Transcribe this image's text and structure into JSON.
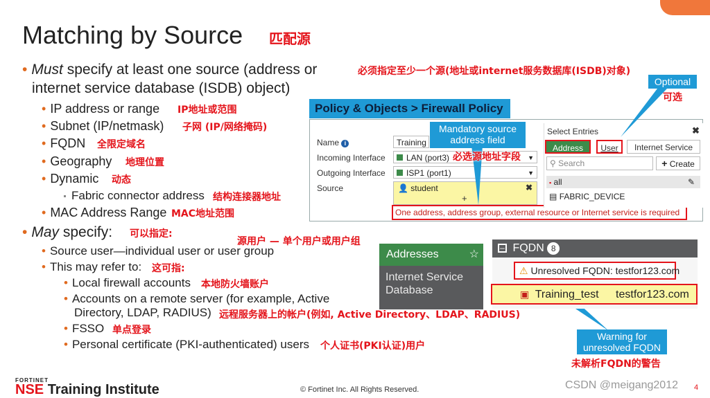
{
  "title": "Matching by Source",
  "title_cn": "匹配源",
  "must": {
    "em": "Must",
    "line1": " specify at least one source (address or",
    "line2": "internet service database (ISDB) object)",
    "cn": "必须指定至少一个源(地址或internet服务数据库(ISDB)对象)",
    "items": [
      {
        "text": "IP address or range",
        "cn": "IP地址或范围"
      },
      {
        "text": "Subnet (IP/netmask)",
        "cn": "子网 (IP/网络掩码)"
      },
      {
        "text": "FQDN",
        "cn": "全限定域名"
      },
      {
        "text": "Geography",
        "cn": "地理位置"
      },
      {
        "text": "Dynamic",
        "cn": "动态"
      },
      {
        "text": "Fabric connector address",
        "cn": "结构连接器地址"
      },
      {
        "text": "MAC Address Range",
        "cn": "MAC地址范围"
      }
    ]
  },
  "may": {
    "em": "May",
    "rest": " specify:",
    "cn": "可以指定:",
    "user_cn": "源用户 — 单个用户或用户组",
    "source_user": "Source user—individual user or user group",
    "refer": "This may refer to:",
    "refer_cn": "这可指:",
    "local": "Local firewall accounts",
    "local_cn": "本地防火墙账户",
    "remote1": "Accounts on a remote server (for example, Active",
    "remote2": "Directory, LDAP, RADIUS)",
    "remote_cn": "远程服务器上的帐户(例如, Active Directory、LDAP、RADIUS)",
    "fsso": "FSSO",
    "fsso_cn": "单点登录",
    "pki": "Personal certificate (PKI-authenticated) users",
    "pki_cn": "个人证书(PKI认证)用户"
  },
  "policy": {
    "header": "Policy & Objects > Firewall Policy",
    "labels": {
      "name": "Name",
      "incoming": "Incoming Interface",
      "outgoing": "Outgoing Interface",
      "source": "Source"
    },
    "name_value": "Training",
    "incoming_value": "LAN (port3)",
    "outgoing_value": "ISP1 (port1)",
    "source_value": "student",
    "plus": "+",
    "required_msg": "One address, address group, external resource or Internet service is required",
    "select_entries": "Select Entries",
    "tabs": [
      "Address",
      "User",
      "Internet Service"
    ],
    "search_placeholder": "Search",
    "create": "Create",
    "entries": [
      "all",
      "FABRIC_DEVICE"
    ]
  },
  "callouts": {
    "optional": "Optional",
    "optional_cn": "可选",
    "mandatory1": "Mandatory source",
    "mandatory2": "address field",
    "mandatory_cn": "必选源地址字段",
    "warning1": "Warning for",
    "warning2": "unresolved FQDN",
    "warning_cn": "未解析FQDN的警告"
  },
  "addresses": {
    "header": "Addresses",
    "isdb1": "Internet Service",
    "isdb2": "Database",
    "fqdn": "FQDN",
    "fqdn_count": "8",
    "unresolved": "Unresolved FQDN: testfor123.com",
    "row_name": "Training_test",
    "row_value": "testfor123.com"
  },
  "footer": {
    "brand_small": "FORTINET",
    "brand_nse": "NSE",
    "brand_rest": "Training Institute",
    "copyright": "© Fortinet Inc. All Rights Reserved.",
    "watermark": "CSDN @meigang2012",
    "page": "4"
  },
  "colors": {
    "accent_blue": "#1f9ad6",
    "red": "#e4141b",
    "orange": "#e06a1f",
    "green": "#3d8b4a"
  }
}
